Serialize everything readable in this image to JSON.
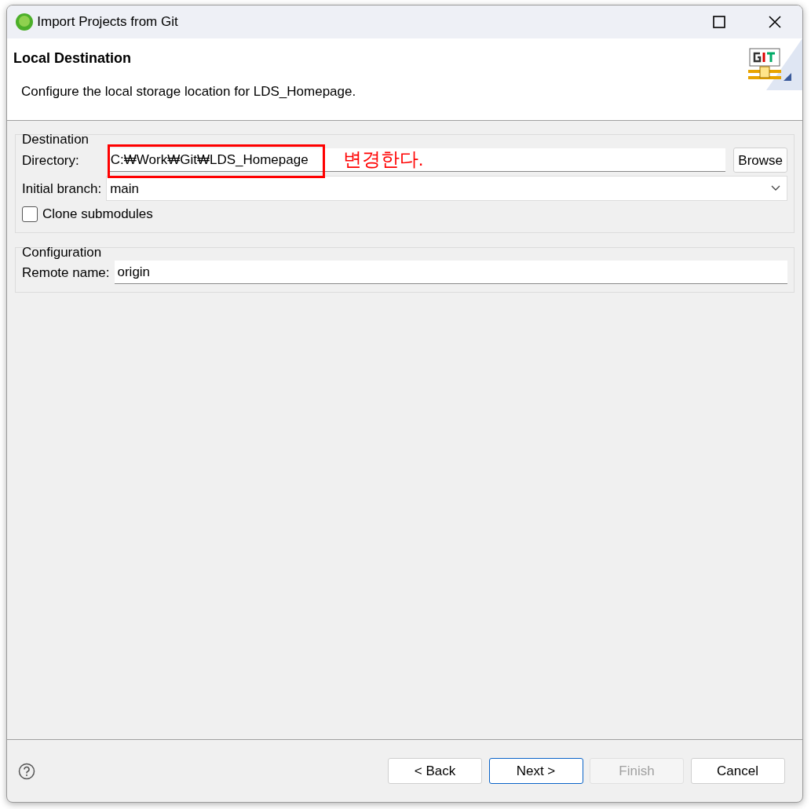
{
  "window": {
    "title": "Import Projects from Git"
  },
  "header": {
    "title": "Local Destination",
    "description": "Configure the local storage location for LDS_Homepage."
  },
  "groups": [
    {
      "title": "Destination",
      "fields": [
        {
          "kind": "path",
          "label": "Directory:",
          "value": "C:₩Work₩Git₩LDS_Homepage",
          "button": "Browse",
          "annotation": "변경한다."
        },
        {
          "kind": "select",
          "label": "Initial branch:",
          "value": "main"
        },
        {
          "kind": "checkbox",
          "label": "Clone submodules",
          "checked": false
        }
      ]
    },
    {
      "title": "Configuration",
      "fields": [
        {
          "kind": "text",
          "label": "Remote name:",
          "value": "origin"
        }
      ]
    }
  ],
  "buttons": [
    {
      "label": "< Back",
      "default": false,
      "disabled": false
    },
    {
      "label": "Next >",
      "default": true,
      "disabled": false
    },
    {
      "label": "Finish",
      "default": false,
      "disabled": true
    },
    {
      "label": "Cancel",
      "default": false,
      "disabled": false
    }
  ]
}
